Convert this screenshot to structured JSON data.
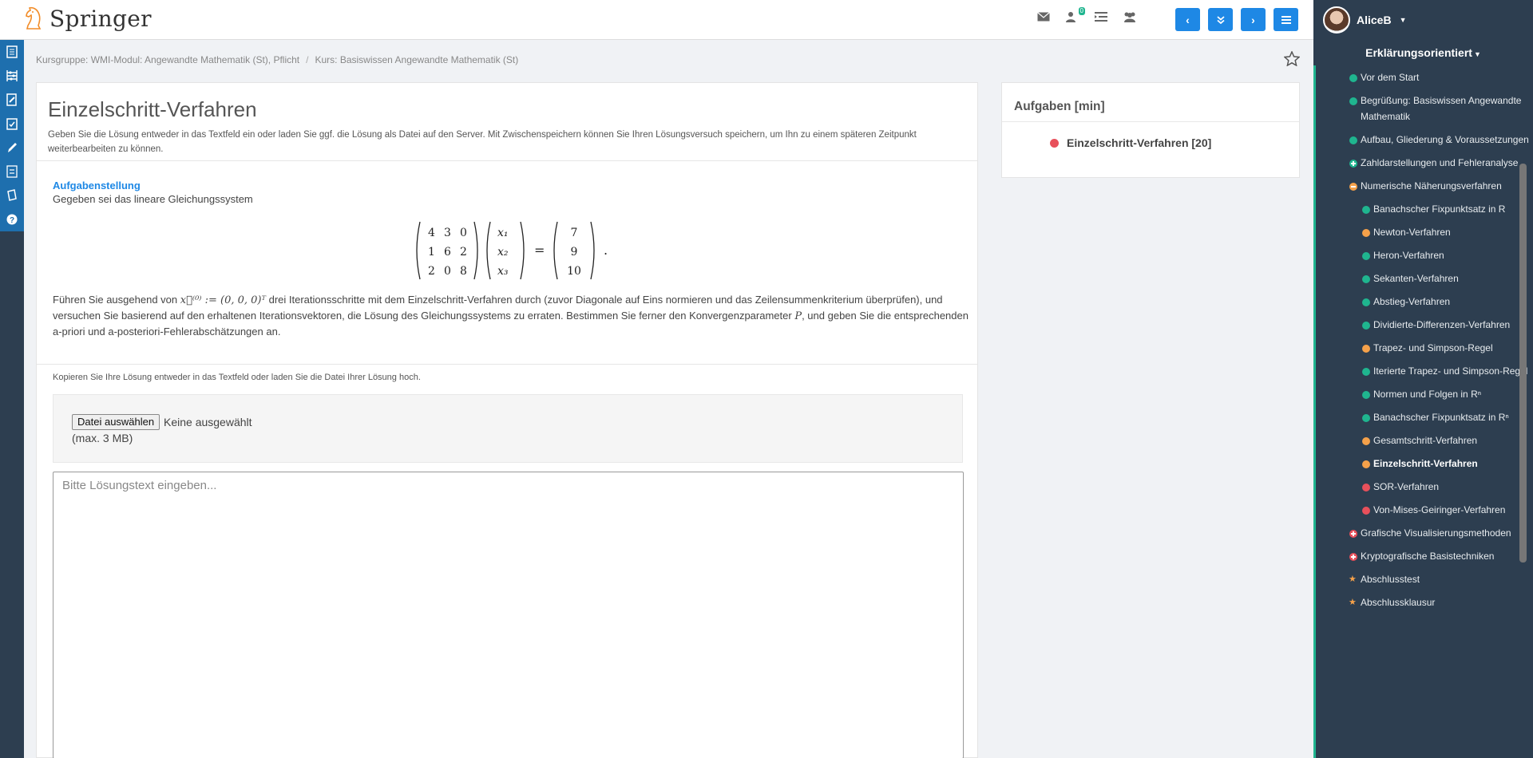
{
  "brand": {
    "name": "Springer"
  },
  "topbar": {
    "badge_count": "0",
    "nav_buttons": [
      "‹",
      "»",
      "›",
      "≡"
    ]
  },
  "breadcrumb": {
    "group": "Kursgruppe: WMI-Modul: Angewandte Mathematik (St), Pflicht",
    "course": "Kurs: Basiswissen Angewandte Mathematik (St)"
  },
  "main": {
    "title": "Einzelschritt-Verfahren",
    "intro": "Geben Sie die Lösung entweder in das Textfeld ein oder laden Sie ggf. die Lösung als Datei auf den Server. Mit Zwischenspeichern können Sie Ihren Lösungsversuch speichern, um Ihn zu einem späteren Zeitpunkt weiterbearbeiten zu können.",
    "task_heading": "Aufgabenstellung",
    "task_sub": "Gegeben sei das lineare Gleichungssystem",
    "matrix": [
      [
        "4",
        "3",
        "0"
      ],
      [
        "1",
        "6",
        "2"
      ],
      [
        "2",
        "0",
        "8"
      ]
    ],
    "vector_x": [
      "x₁",
      "x₂",
      "x₃"
    ],
    "rhs": [
      "7",
      "9",
      "10"
    ],
    "task_text_1": "Führen Sie ausgehend von",
    "task_text_math": "x⃗⁽⁰⁾ := (0, 0, 0)ᵀ",
    "task_text_2": "drei Iterationsschritte mit dem Einzelschritt-Verfahren durch (zuvor Diagonale auf Eins normieren und das Zeilensummenkriterium überprüfen), und versuchen Sie basierend auf den erhaltenen Iterationsvektoren, die Lösung des Gleichungssystems zu erraten. Bestimmen Sie ferner den Konvergenzparameter",
    "task_text_p": "P",
    "task_text_3": ", und geben Sie die entsprechenden a-priori und a-posteriori-Fehlerabschätzungen an.",
    "copy_note": "Kopieren Sie Ihre Lösung entweder in das Textfeld oder laden Sie die Datei Ihrer Lösung hoch.",
    "file_button": "Datei auswählen",
    "file_none": "Keine ausgewählt",
    "file_max": "(max. 3 MB)",
    "solution_placeholder": "Bitte Lösungstext eingeben..."
  },
  "tasks_panel": {
    "title": "Aufgaben [min]",
    "items": [
      {
        "label": "Einzelschritt-Verfahren [20]",
        "status_color": "#e8505b"
      }
    ]
  },
  "sidebar": {
    "user": "AliceB",
    "title": "Erklärungsorientiert",
    "items": [
      {
        "label": "Vor dem Start",
        "color": "#1fb58f",
        "level": 1,
        "type": "dot"
      },
      {
        "label": "Begrüßung: Basiswissen Angewandte Mathematik",
        "color": "#1fb58f",
        "level": 1,
        "type": "dot"
      },
      {
        "label": "Aufbau, Gliederung & Voraussetzungen",
        "color": "#1fb58f",
        "level": 1,
        "type": "dot"
      },
      {
        "label": "Zahldarstellungen und Fehleranalyse",
        "color": "#1fb58f",
        "level": 1,
        "type": "plus"
      },
      {
        "label": "Numerische Näherungsverfahren",
        "color": "#f5a14a",
        "level": 1,
        "type": "minus"
      },
      {
        "label": "Banachscher Fixpunktsatz in R",
        "color": "#1fb58f",
        "level": 2,
        "type": "dot"
      },
      {
        "label": "Newton-Verfahren",
        "color": "#f5a14a",
        "level": 2,
        "type": "dot"
      },
      {
        "label": "Heron-Verfahren",
        "color": "#1fb58f",
        "level": 2,
        "type": "dot"
      },
      {
        "label": "Sekanten-Verfahren",
        "color": "#1fb58f",
        "level": 2,
        "type": "dot"
      },
      {
        "label": "Abstieg-Verfahren",
        "color": "#1fb58f",
        "level": 2,
        "type": "dot"
      },
      {
        "label": "Dividierte-Differenzen-Verfahren",
        "color": "#1fb58f",
        "level": 2,
        "type": "dot"
      },
      {
        "label": "Trapez- und Simpson-Regel",
        "color": "#f5a14a",
        "level": 2,
        "type": "dot"
      },
      {
        "label": "Iterierte Trapez- und Simpson-Regel",
        "color": "#1fb58f",
        "level": 2,
        "type": "dot"
      },
      {
        "label": "Normen und Folgen in Rⁿ",
        "color": "#1fb58f",
        "level": 2,
        "type": "dot"
      },
      {
        "label": "Banachscher Fixpunktsatz in Rⁿ",
        "color": "#1fb58f",
        "level": 2,
        "type": "dot"
      },
      {
        "label": "Gesamtschritt-Verfahren",
        "color": "#f5a14a",
        "level": 2,
        "type": "dot"
      },
      {
        "label": "Einzelschritt-Verfahren",
        "color": "#f5a14a",
        "level": 2,
        "type": "dot",
        "active": true
      },
      {
        "label": "SOR-Verfahren",
        "color": "#e8505b",
        "level": 2,
        "type": "dot"
      },
      {
        "label": "Von-Mises-Geiringer-Verfahren",
        "color": "#e8505b",
        "level": 2,
        "type": "dot"
      },
      {
        "label": "Grafische Visualisierungsmethoden",
        "color": "#e8505b",
        "level": 1,
        "type": "plus"
      },
      {
        "label": "Kryptografische Basistechniken",
        "color": "#e8505b",
        "level": 1,
        "type": "plus"
      },
      {
        "label": "Abschlusstest",
        "color": "#f5a14a",
        "level": 1,
        "type": "star"
      },
      {
        "label": "Abschlussklausur",
        "color": "#f5a14a",
        "level": 1,
        "type": "star"
      }
    ]
  }
}
